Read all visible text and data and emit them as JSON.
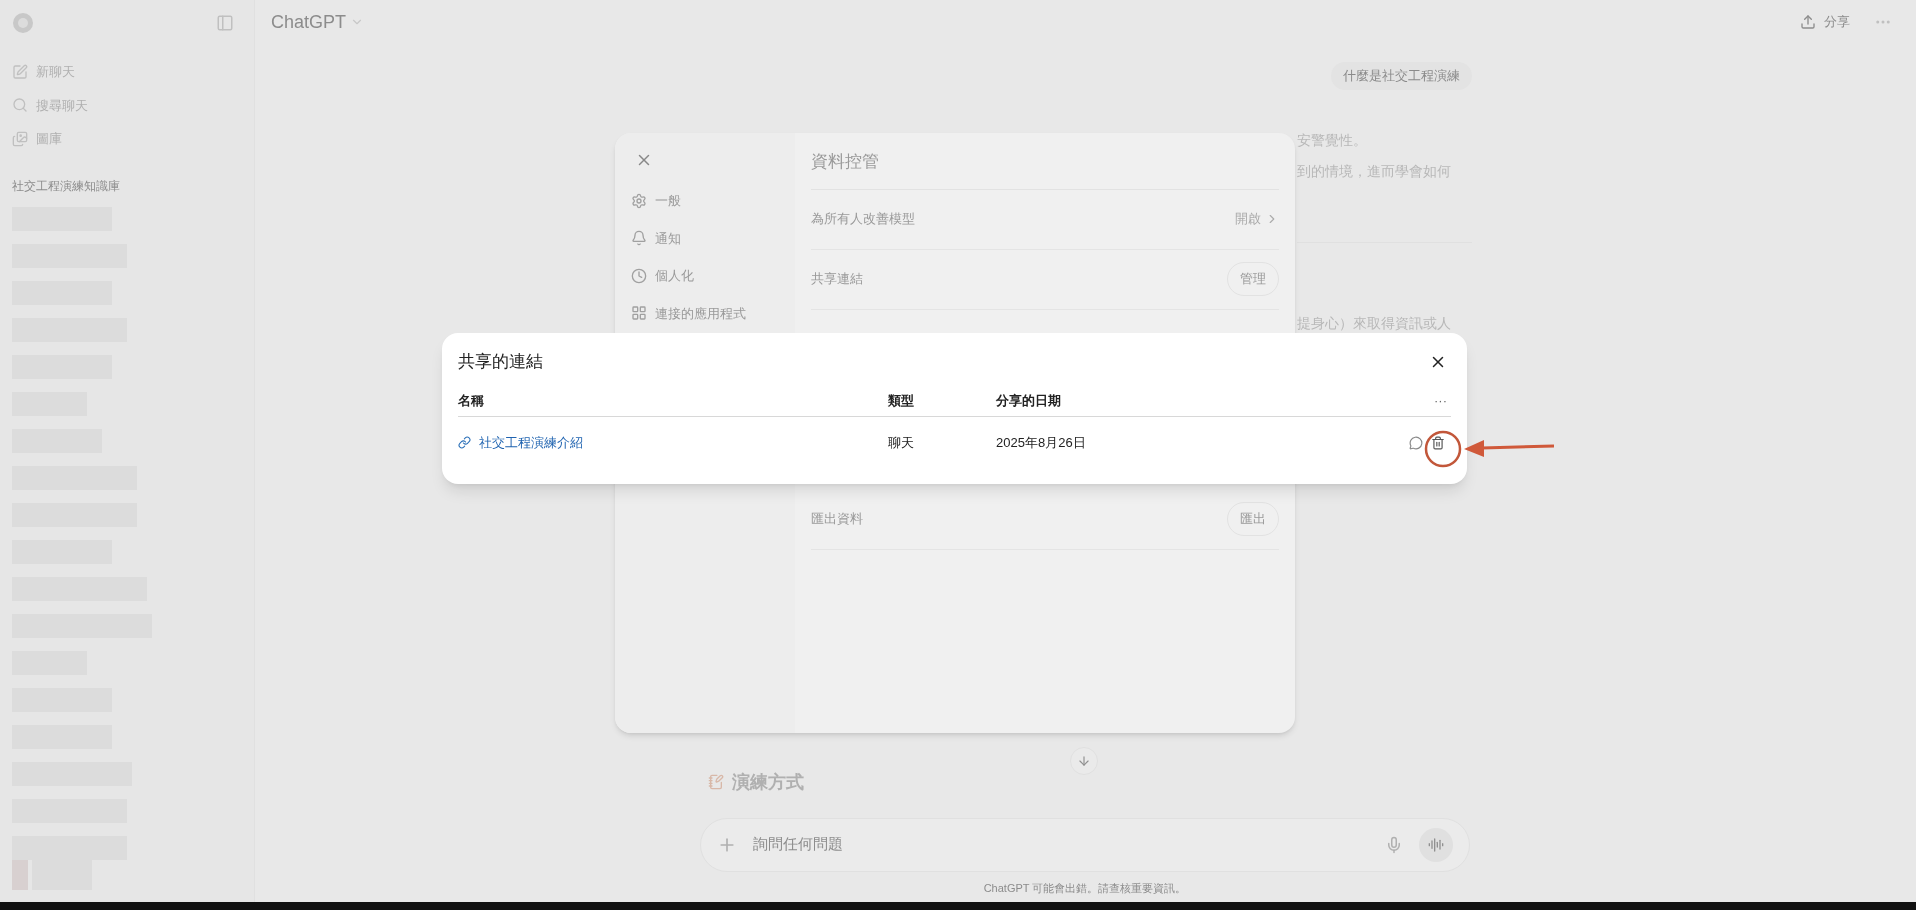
{
  "sidebar": {
    "items": [
      {
        "kind": "new",
        "label": "新聊天"
      },
      {
        "kind": "search",
        "label": "搜尋聊天"
      },
      {
        "kind": "library",
        "label": "圖庫"
      }
    ],
    "section_title": "社交工程演練知識庫"
  },
  "topbar": {
    "title": "ChatGPT",
    "share": "分享"
  },
  "chat": {
    "user_message": "什麼是社交工程演練",
    "answer_lines": [
      "安警覺性。",
      "到的情境，進而學會如何",
      "提身心）來取得資訊或人"
    ],
    "section_heading": "演練方式",
    "input_placeholder": "詢問任何問題",
    "footer": "ChatGPT 可能會出錯。請查核重要資訊。"
  },
  "settings": {
    "nav": [
      {
        "kind": "general",
        "label": "一般"
      },
      {
        "kind": "notify",
        "label": "通知"
      },
      {
        "kind": "personal",
        "label": "個人化"
      },
      {
        "kind": "apps",
        "label": "連接的應用程式"
      }
    ],
    "title": "資料控管",
    "rows": [
      {
        "label": "為所有人改善模型",
        "kind": "link",
        "value": "開啟"
      },
      {
        "label": "共享連結",
        "kind": "button",
        "value": "管理"
      },
      {
        "label": "匯出資料",
        "kind": "button",
        "value": "匯出"
      }
    ]
  },
  "shared_links": {
    "title": "共享的連結",
    "columns": [
      "名稱",
      "類型",
      "分享的日期"
    ],
    "more": "···",
    "rows": [
      {
        "name": "社交工程演練介紹",
        "type": "聊天",
        "date": "2025年8月26日"
      }
    ]
  }
}
